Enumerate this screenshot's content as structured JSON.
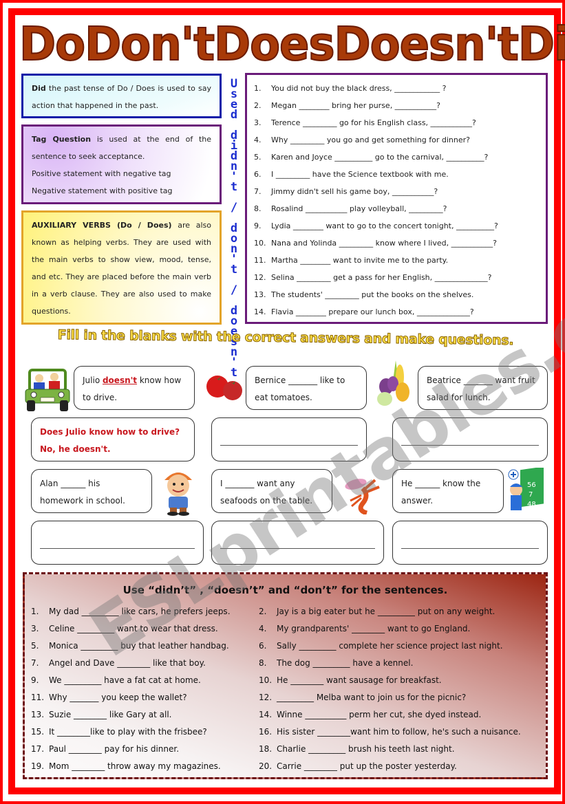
{
  "title": {
    "words": [
      "Do",
      "Don't",
      "Does",
      "Doesn't",
      "Did"
    ]
  },
  "info_boxes": {
    "did": {
      "bold": "Did",
      "text": " the past tense of Do / Does is used to say action that happened in the past."
    },
    "tag": {
      "bold": "Tag Question",
      "text": " is used at the end of the sentence to seek acceptance.",
      "line2": "Positive statement with negative tag",
      "line3": "Negative statement with positive tag"
    },
    "aux": {
      "bold": "AUXILIARY VERBS (Do / Does)",
      "text": " are also known as helping verbs.  They are used with the main verbs to show view, mood, tense, and etc.  They are placed before the main verb in a verb clause.  They are also used to make questions."
    }
  },
  "vertical_label": "Used didn't / don't / doesn't",
  "tag_questions": [
    {
      "num": "1.",
      "text": "You did not buy the black dress, ____________ ?"
    },
    {
      "num": "2.",
      "text": "Megan ________ bring her purse, ___________?"
    },
    {
      "num": "3.",
      "text": "Terence _________ go for his English class, ___________?"
    },
    {
      "num": "4.",
      "text": "Why _________ you go and get something for dinner?"
    },
    {
      "num": "5.",
      "text": "Karen and Joyce __________ go to the carnival, __________?"
    },
    {
      "num": "6.",
      "text": "I _________ have the Science textbook with me."
    },
    {
      "num": "7.",
      "text": "Jimmy didn't sell his game boy, ___________?"
    },
    {
      "num": "8.",
      "text": "Rosalind ___________ play volleyball, _________?"
    },
    {
      "num": "9.",
      "text": "Lydia ________ want to go to the concert tonight, __________?"
    },
    {
      "num": "10.",
      "text": "Nana and Yolinda _________ know where I lived, ___________?"
    },
    {
      "num": "11.",
      "text": "Martha ________ want to invite me to the party."
    },
    {
      "num": "12.",
      "text": "Selina _________ get a pass for her English, ______________?"
    },
    {
      "num": "13.",
      "text": "The students' _________ put the books on the shelves."
    },
    {
      "num": "14.",
      "text": "Flavia ________ prepare our lunch box, ______________?"
    }
  ],
  "instruction": "Fill in the blanks with the correct answers and make questions.",
  "cards": {
    "julio": {
      "pre": "Julio ",
      "highlight": "doesn't",
      "post": " know how to drive."
    },
    "julio_answer": {
      "line1": "Does Julio know how to drive?",
      "line2": "No, he doesn't."
    },
    "bernice": "Bernice _______ like to eat tomatoes.",
    "beatrice": "Beatrice _______ want fruit salad for lunch.",
    "alan": "Alan ______ his homework in school.",
    "seafood": "I _______ want any seafoods on the table.",
    "he": "He ______ know the answer."
  },
  "pictures": {
    "jeep": "jeep-icon",
    "tomatoes": "tomatoes-icon",
    "vegetables": "vegetables-icon",
    "boy": "boy-icon",
    "seafood": "seafood-icon",
    "student": "student-math-icon"
  },
  "exercise": {
    "heading": "Use “didn’t” , “doesn’t” and “don’t” for the sentences.",
    "left": [
      {
        "num": "1.",
        "text": "My dad _________ like cars, he prefers jeeps."
      },
      {
        "num": "3.",
        "text": "Celine _________ want to wear that dress."
      },
      {
        "num": "5.",
        "text": "Monica _________ buy that leather handbag."
      },
      {
        "num": "7.",
        "text": "Angel and Dave ________ like that boy."
      },
      {
        "num": "9.",
        "text": "We _________ have a fat cat at home."
      },
      {
        "num": "11.",
        "text": "Why _______ you keep the wallet?"
      },
      {
        "num": "13.",
        "text": "Suzie ________ like Gary at all."
      },
      {
        "num": "15.",
        "text": "It ________like to play with the frisbee?"
      },
      {
        "num": "17.",
        "text": "Paul ________ pay for his dinner."
      },
      {
        "num": "19.",
        "text": "Mom ________ throw away my magazines."
      }
    ],
    "right": [
      {
        "num": "2.",
        "text": "Jay is a big eater but he _________ put on any weight."
      },
      {
        "num": "4.",
        "text": "My grandparents' ________ want to go England."
      },
      {
        "num": "6.",
        "text": "Sally _________ complete her science project last night."
      },
      {
        "num": "8.",
        "text": "The dog _________ have a kennel."
      },
      {
        "num": "10.",
        "text": "He ________ want sausage for breakfast."
      },
      {
        "num": "12.",
        "text": "_________ Melba want to join us for the picnic?"
      },
      {
        "num": "14.",
        "text": "Winne __________ perm her cut, she dyed instead."
      },
      {
        "num": "16.",
        "text": "His sister ________want him to follow, he's such a nuisance."
      },
      {
        "num": "18.",
        "text": "Charlie _________ brush his teeth last night."
      },
      {
        "num": "20.",
        "text": "Carrie ________ put up the poster yesterday."
      }
    ]
  },
  "watermark": "ESLprintables.com",
  "colors": {
    "frame": "#ff0000",
    "title": "#a83a08",
    "did_border": "#0b1aa8",
    "tag_border": "#6a1b79",
    "aux_border": "#e3a42a",
    "vertical_text": "#1d2fd0",
    "answer_red": "#c8171e",
    "exercise_border": "#6b0d12"
  }
}
